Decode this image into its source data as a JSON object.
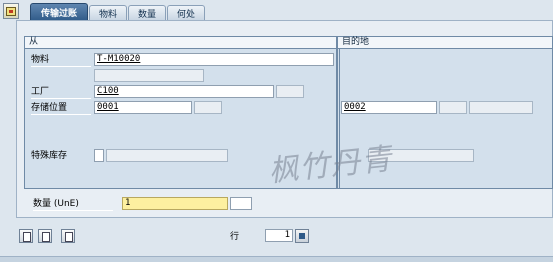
{
  "tabs": [
    {
      "label": "传输过账",
      "active": true
    },
    {
      "label": "物料",
      "active": false
    },
    {
      "label": "数量",
      "active": false
    },
    {
      "label": "何处",
      "active": false
    }
  ],
  "from": {
    "title": "从",
    "material_label": "物料",
    "material_value": "T-M10020",
    "plant_label": "工厂",
    "plant_value": "C100",
    "storage_label": "存储位置",
    "storage_value": "0001",
    "special_stock_label": "特殊库存"
  },
  "to": {
    "title": "目的地",
    "storage_value": "0002"
  },
  "quantity": {
    "label": "数量 (UnE)",
    "value": "1"
  },
  "row": {
    "label": "行",
    "value": "1"
  },
  "watermark": "枫竹丹青",
  "colors": {
    "active_tab": "#2f5a88",
    "frame_bg": "#d3e0ec",
    "quantity_field": "#fdf0a0"
  }
}
